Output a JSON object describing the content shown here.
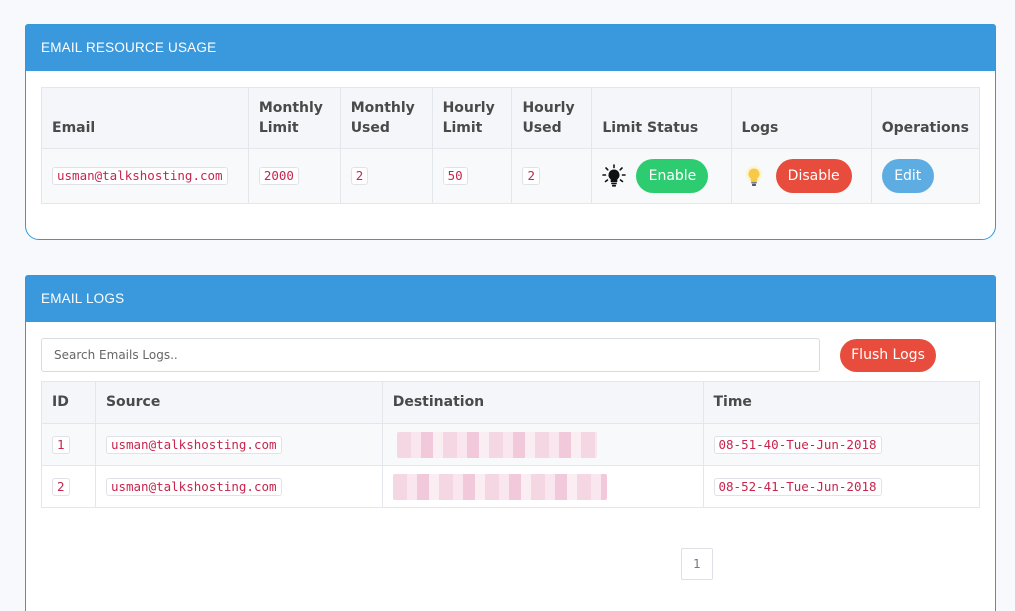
{
  "usage": {
    "title": "EMAIL RESOURCE USAGE",
    "headers": {
      "email": "Email",
      "monthly_limit": "Monthly Limit",
      "monthly_used": "Monthly Used",
      "hourly_limit": "Hourly Limit",
      "hourly_used": "Hourly Used",
      "limit_status": "Limit Status",
      "logs": "Logs",
      "operations": "Operations"
    },
    "row": {
      "email": "usman@talkshosting.com",
      "monthly_limit": "2000",
      "monthly_used": "2",
      "hourly_limit": "50",
      "hourly_used": "2",
      "limit_status_button": "Enable",
      "logs_button": "Disable",
      "edit_button": "Edit"
    }
  },
  "logs": {
    "title": "EMAIL LOGS",
    "search_placeholder": "Search Emails Logs..",
    "flush_button": "Flush Logs",
    "headers": {
      "id": "ID",
      "source": "Source",
      "destination": "Destination",
      "time": "Time"
    },
    "rows": [
      {
        "id": "1",
        "source": "usman@talkshosting.com",
        "time": "08-51-40-Tue-Jun-2018"
      },
      {
        "id": "2",
        "source": "usman@talkshosting.com",
        "time": "08-52-41-Tue-Jun-2018"
      }
    ],
    "pagination": {
      "current": "1"
    }
  },
  "colors": {
    "header_blue": "#3a98dc",
    "enable_green": "#2ecc71",
    "disable_red": "#e74c3c",
    "edit_blue": "#5dade2",
    "code_pink": "#c7254e"
  }
}
